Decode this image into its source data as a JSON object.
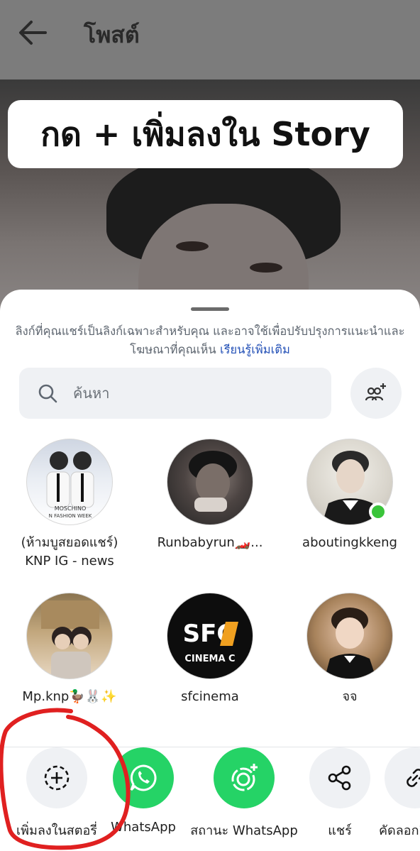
{
  "header": {
    "title": "โพสต์"
  },
  "caption": "กด + เพิ่มลงใน Story",
  "sheet": {
    "notice_text": "ลิงก์ที่คุณแชร์เป็นลิงก์เฉพาะสำหรับคุณ และอาจใช้เพื่อปรับปรุงการแนะนำและโฆษณาที่คุณเห็น",
    "learn_more": "เรียนรู้เพิ่มเติม",
    "search_placeholder": "ค้นหา"
  },
  "contacts": [
    {
      "name_line1": "(ห้ามบูสยอดแชร์)",
      "name_line2": "KNP IG - news",
      "online": false
    },
    {
      "name_line1": "Runbabyrun🏎️...",
      "name_line2": "",
      "online": false
    },
    {
      "name_line1": "aboutingkkeng",
      "name_line2": "",
      "online": true
    },
    {
      "name_line1": "Mp.knp🦆🐰✨",
      "name_line2": "",
      "online": false
    },
    {
      "name_line1": "sfcinema",
      "name_line2": "",
      "online": false
    },
    {
      "name_line1": "จจ",
      "name_line2": "",
      "online": false
    }
  ],
  "avatar_text": {
    "sfc_logo": "SFC",
    "sfc_sub": "CINEMA C",
    "moschino": "MOSCHINO",
    "fashion_week": "N FASHION WEEK"
  },
  "actions": [
    {
      "label": "เพิ่มลงในสตอรี่",
      "icon": "add-story-icon",
      "style": "gray"
    },
    {
      "label": "WhatsApp",
      "icon": "whatsapp-icon",
      "style": "green"
    },
    {
      "label": "สถานะ WhatsApp",
      "icon": "whatsapp-status-icon",
      "style": "green"
    },
    {
      "label": "แชร์",
      "icon": "share-icon",
      "style": "gray"
    },
    {
      "label": "คัดลอกลิงก์",
      "icon": "link-icon",
      "style": "gray"
    }
  ],
  "colors": {
    "whatsapp_green": "#25d366",
    "link_blue": "#2451b7",
    "online_green": "#3ac43a",
    "annotation_red": "#e02020"
  }
}
